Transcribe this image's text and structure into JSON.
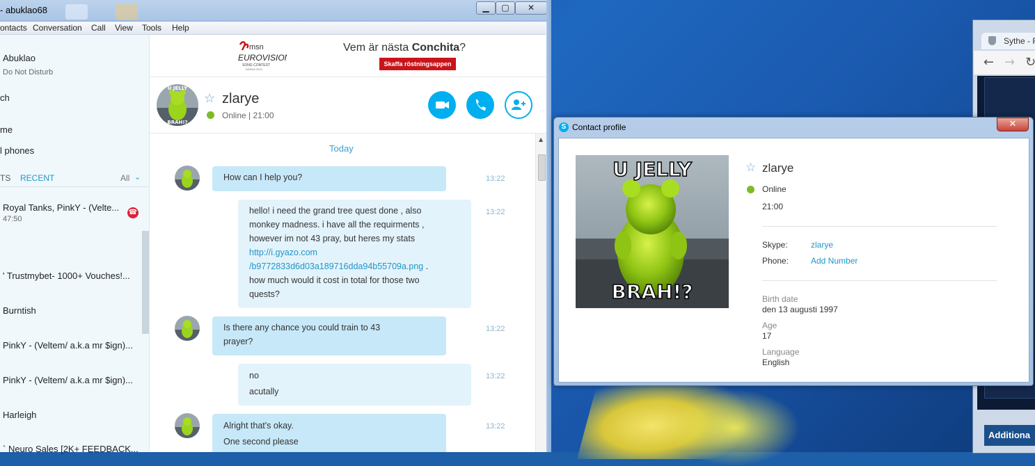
{
  "skype": {
    "window_title": "- abuklao68",
    "menu": [
      "ontacts",
      "Conversation",
      "Call",
      "View",
      "Tools",
      "Help"
    ],
    "profile": {
      "name": "Abuklao",
      "status": "Do Not Disturb"
    },
    "nav": {
      "search": "ch",
      "home": "me",
      "phones": "l phones"
    },
    "tabs": {
      "contacts": "TS",
      "recent": "RECENT",
      "filter": "All"
    },
    "recent": [
      {
        "name": "Royal Tanks, PinkY - (Velte...",
        "sub": "47:50"
      },
      {
        "name": "' Trustmybet- 1000+ Vouches!..."
      },
      {
        "name": "Burntish"
      },
      {
        "name": "PinkY - (Veltem/ a.k.a mr $ign)..."
      },
      {
        "name": "PinkY - (Veltem/ a.k.a mr $ign)..."
      },
      {
        "name": "Harleigh"
      },
      {
        "name": "` Neuro Sales [2K+ FEEDBACK..."
      }
    ],
    "ad": {
      "brand_top": "msn",
      "brand_main": "EUROVISION",
      "brand_sub": "SONG CONTEST",
      "brand_loc": "VIENNA 2015",
      "text_prefix": "Vem är nästa ",
      "text_bold": "Conchita",
      "text_suffix": "?",
      "button": "Skaffa röstningsappen"
    },
    "contact": {
      "name": "zlarye",
      "status": "Online",
      "separator": "|",
      "time": "21:00"
    },
    "chat": {
      "day": "Today",
      "messages": [
        {
          "from": "them",
          "lines": [
            "How can I help you?"
          ],
          "time": "13:22"
        },
        {
          "from": "me",
          "lines": [
            "hello! i need the grand tree quest done , also",
            "monkey madness. i have all the requirments ,",
            "however im not 43 pray, but heres my stats"
          ],
          "link1": "http://i.gyazo.com",
          "link2": "/b9772833d6d03a189716dda94b55709a.png",
          "after_link": " .",
          "lines2": [
            "how much would it cost in total for those two",
            "quests?"
          ],
          "time": "13:22"
        },
        {
          "from": "them",
          "lines": [
            "Is there any chance you could train to 43",
            "prayer?"
          ],
          "time": "13:22"
        },
        {
          "from": "me",
          "lines": [
            "no",
            "acutally"
          ],
          "time": "13:22"
        },
        {
          "from": "them",
          "lines": [
            "Alright that's okay.",
            "One second please"
          ],
          "time": "13:22"
        }
      ]
    }
  },
  "profile_dialog": {
    "title": "Contact profile",
    "close": "✕",
    "name": "zlarye",
    "status": "Online",
    "time": "21:00",
    "skype_label": "Skype:",
    "skype_value": "zlarye",
    "phone_label": "Phone:",
    "phone_value": "Add Number",
    "birth_label": "Birth date",
    "birth_value": "den 13 augusti 1997",
    "age_label": "Age",
    "age_value": "17",
    "language_label": "Language",
    "language_value": "English",
    "picture_top_text": "U JELLY",
    "picture_bottom_text": "BRAH!?"
  },
  "browser": {
    "tab_title": "Sythe - F",
    "panel_heading": "Additiona"
  },
  "colors": {
    "skype_blue": "#00aff0",
    "online_green": "#7dbb2b",
    "bubble_them": "#c7e8f8",
    "bubble_me": "#e3f3fb",
    "ad_red": "#c8141a"
  }
}
